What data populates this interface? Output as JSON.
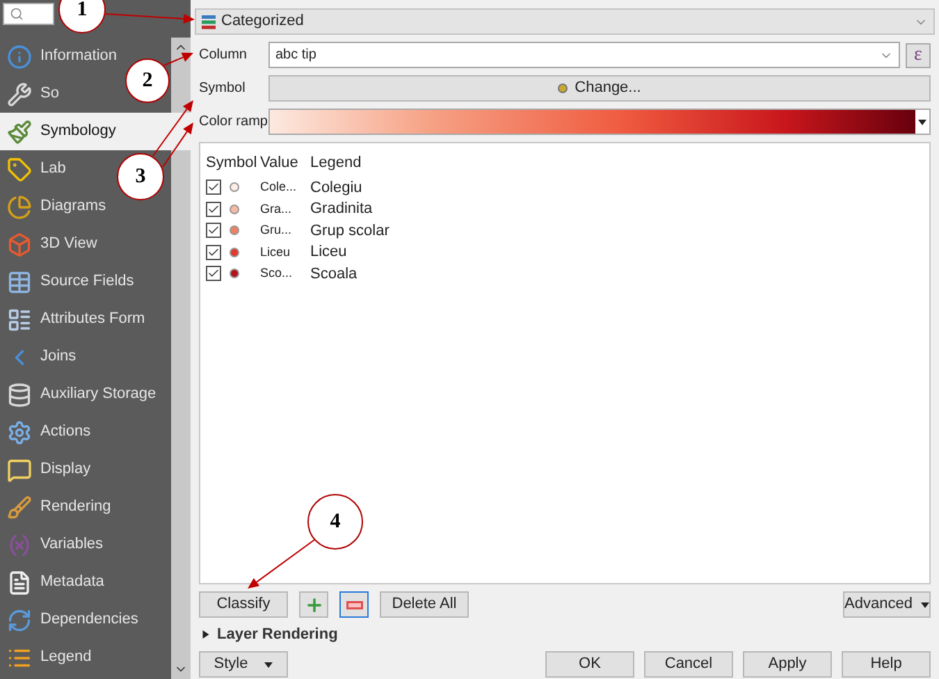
{
  "sidebar": {
    "items": [
      {
        "label": "Information",
        "selected": false
      },
      {
        "label": "So",
        "selected": false
      },
      {
        "label": "Symbology",
        "selected": true
      },
      {
        "label": "Lab",
        "selected": false
      },
      {
        "label": "Diagrams",
        "selected": false
      },
      {
        "label": "3D View",
        "selected": false
      },
      {
        "label": "Source Fields",
        "selected": false
      },
      {
        "label": "Attributes Form",
        "selected": false
      },
      {
        "label": "Joins",
        "selected": false
      },
      {
        "label": "Auxiliary Storage",
        "selected": false
      },
      {
        "label": "Actions",
        "selected": false
      },
      {
        "label": "Display",
        "selected": false
      },
      {
        "label": "Rendering",
        "selected": false
      },
      {
        "label": "Variables",
        "selected": false
      },
      {
        "label": "Metadata",
        "selected": false
      },
      {
        "label": "Dependencies",
        "selected": false
      },
      {
        "label": "Legend",
        "selected": false
      }
    ]
  },
  "renderer": {
    "value": "Categorized"
  },
  "column": {
    "label": "Column",
    "value": "abc tip",
    "expression_button": "ε"
  },
  "symbol": {
    "label": "Symbol",
    "button": "Change..."
  },
  "color_ramp": {
    "label": "Color ramp"
  },
  "table": {
    "columns": [
      "Symbol",
      "Value",
      "Legend"
    ],
    "rows": [
      {
        "checked": true,
        "color": "#fdeee8",
        "value": "Cole...",
        "legend": "Colegiu"
      },
      {
        "checked": true,
        "color": "#f7b9a3",
        "value": "Gra...",
        "legend": "Gradinita"
      },
      {
        "checked": true,
        "color": "#f08064",
        "value": "Gru...",
        "legend": "Grup scolar"
      },
      {
        "checked": true,
        "color": "#e3382c",
        "value": "Liceu",
        "legend": "Liceu"
      },
      {
        "checked": true,
        "color": "#b3141c",
        "value": "Sco...",
        "legend": "Scoala"
      }
    ]
  },
  "buttons": {
    "classify": "Classify",
    "delete_all": "Delete All",
    "advanced": "Advanced"
  },
  "layer_rendering": {
    "label": "Layer Rendering",
    "expanded": false
  },
  "footer": {
    "style": "Style",
    "buttons": [
      "OK",
      "Cancel",
      "Apply",
      "Help"
    ]
  },
  "callouts": [
    {
      "number": "1"
    },
    {
      "number": "2"
    },
    {
      "number": "3"
    },
    {
      "number": "4"
    }
  ]
}
